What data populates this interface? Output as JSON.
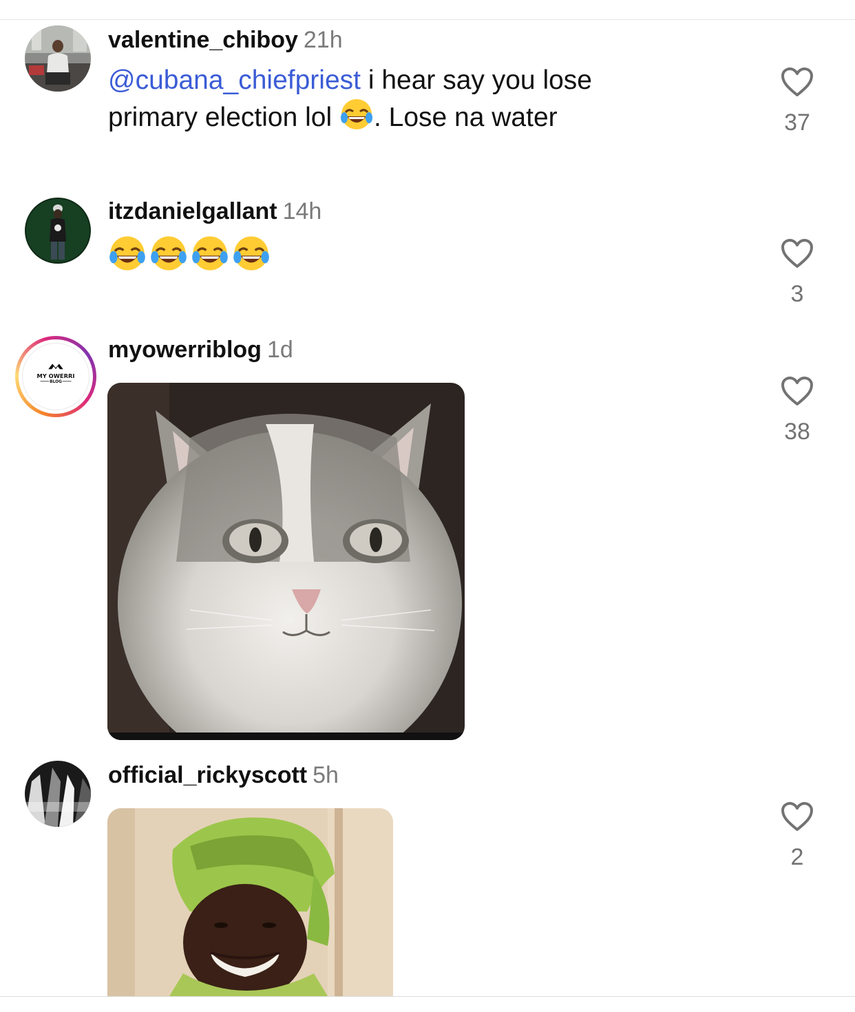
{
  "comments": [
    {
      "username": "valentine_chiboy",
      "time": "21h",
      "mention": "@cubana_chiefpriest",
      "text_line1": " i hear say you lose",
      "text_line2_a": "primary election lol ",
      "text_line2_b": ". Lose na water",
      "likes": "37",
      "avatar": "person-seated-photo"
    },
    {
      "username": "itzdanielgallant",
      "time": "14h",
      "emoji_count": 4,
      "likes": "3",
      "avatar": "person-stage-photo"
    },
    {
      "username": "myowerriblog",
      "time": "1d",
      "avatar_logo_text": "MY OWERRI",
      "avatar_logo_sub": "BLOG",
      "media": "cat-gif",
      "likes": "38"
    },
    {
      "username": "official_rickyscott",
      "time": "5h",
      "media": "woman-headwrap-gif",
      "likes": "2",
      "avatar": "monochrome-abstract-photo"
    }
  ],
  "icons": {
    "like": "heart-outline-icon",
    "laugh": "face-with-tears-of-joy-emoji"
  },
  "colors": {
    "mention": "#3b5cd6",
    "muted": "#737373",
    "story_ring": [
      "#f58529",
      "#dd2a7b",
      "#8134af"
    ]
  }
}
